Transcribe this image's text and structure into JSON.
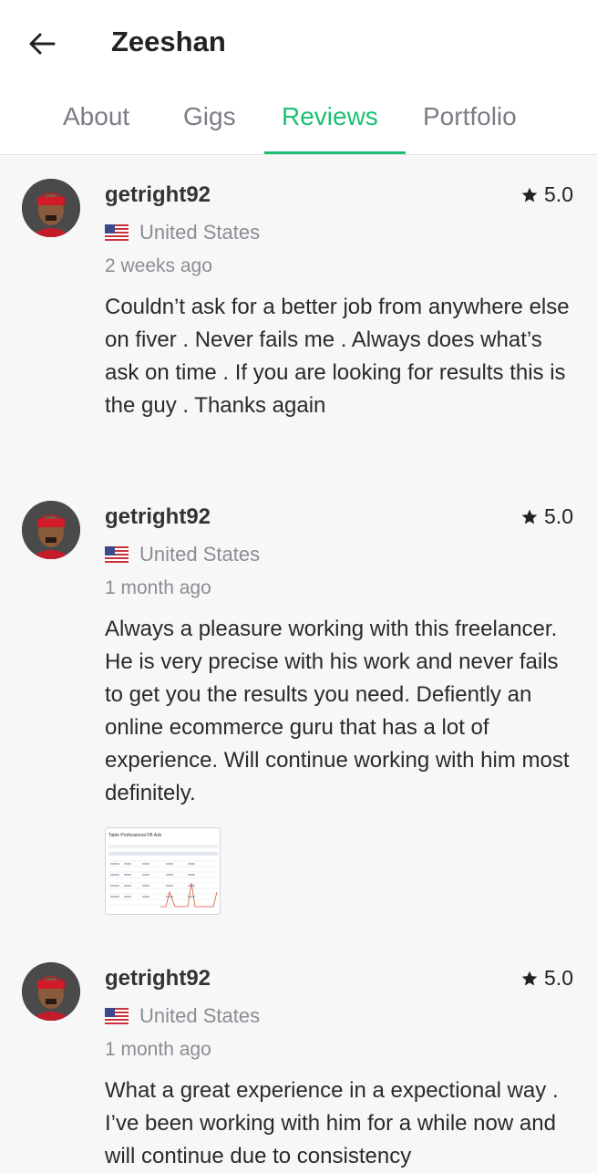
{
  "header": {
    "title": "Zeeshan",
    "back_icon": "arrow-left-icon"
  },
  "tabs": [
    {
      "label": "About",
      "active": false
    },
    {
      "label": "Gigs",
      "active": false
    },
    {
      "label": "Reviews",
      "active": true
    },
    {
      "label": "Portfolio",
      "active": false
    }
  ],
  "colors": {
    "accent": "#1dbf73",
    "muted": "#8a8d94"
  },
  "reviews": [
    {
      "username": "getright92",
      "rating": "5.0",
      "country": "United States",
      "time": "2 weeks ago",
      "text": "Couldn’t ask for a better job from anywhere else on fiver . Never fails me . Always does what’s ask on time . If you are looking for results this is the guy . Thanks again"
    },
    {
      "username": "getright92",
      "rating": "5.0",
      "country": "United States",
      "time": "1 month ago",
      "text": "Always a pleasure working with this freelancer. He is very precise with his work and never fails to get you the results you need. Defiently an online ecommerce guru that has a lot of experience. Will continue working with him most definitely.",
      "attachment_caption": "Table Professional FB Ads"
    },
    {
      "username": "getright92",
      "rating": "5.0",
      "country": "United States",
      "time": "1 month ago",
      "text": "What a great experience in a expectional way . I’ve been working with him for a while now and will continue due to consistency"
    }
  ]
}
